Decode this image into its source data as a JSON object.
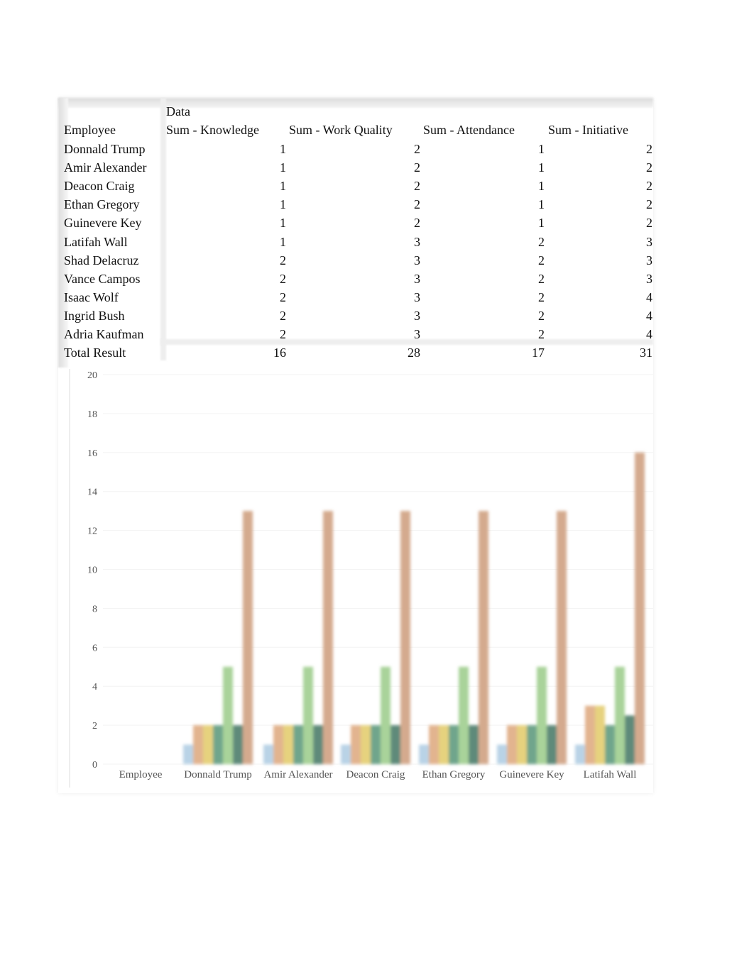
{
  "pivot": {
    "data_label": "Data",
    "row_header": "Employee",
    "columns": [
      "Sum - Knowledge",
      "Sum - Work Quality",
      "Sum - Attendance",
      "Sum - Initiative"
    ],
    "rows": [
      {
        "name": "Donnald Trump",
        "values": [
          1,
          2,
          1,
          2
        ]
      },
      {
        "name": "Amir Alexander",
        "values": [
          1,
          2,
          1,
          2
        ]
      },
      {
        "name": "Deacon Craig",
        "values": [
          1,
          2,
          1,
          2
        ]
      },
      {
        "name": "Ethan Gregory",
        "values": [
          1,
          2,
          1,
          2
        ]
      },
      {
        "name": "Guinevere Key",
        "values": [
          1,
          2,
          1,
          2
        ]
      },
      {
        "name": "Latifah Wall",
        "values": [
          1,
          3,
          2,
          3
        ]
      },
      {
        "name": "Shad Delacruz",
        "values": [
          2,
          3,
          2,
          3
        ]
      },
      {
        "name": "Vance Campos",
        "values": [
          2,
          3,
          2,
          3
        ]
      },
      {
        "name": "Isaac Wolf",
        "values": [
          2,
          3,
          2,
          4
        ]
      },
      {
        "name": "Ingrid Bush",
        "values": [
          2,
          3,
          2,
          4
        ]
      },
      {
        "name": "Adria Kaufman",
        "values": [
          2,
          3,
          2,
          4
        ]
      }
    ],
    "total": {
      "name": "Total Result",
      "values": [
        16,
        28,
        17,
        31
      ]
    }
  },
  "chart_data": {
    "type": "bar",
    "ylim": [
      0,
      20
    ],
    "yticks": [
      0,
      2,
      4,
      6,
      8,
      10,
      12,
      14,
      16,
      18,
      20
    ],
    "categories": [
      "Employee",
      "Donnald Trump",
      "Amir Alexander",
      "Deacon Craig",
      "Ethan Gregory",
      "Guinevere Key",
      "Latifah Wall"
    ],
    "grid": true,
    "series": [
      {
        "color": "#b9d3e6",
        "values": [
          0,
          1,
          1,
          1,
          1,
          1,
          1
        ]
      },
      {
        "color": "#e2b48f",
        "values": [
          0,
          2,
          2,
          2,
          2,
          2,
          3
        ]
      },
      {
        "color": "#e6d27e",
        "values": [
          0,
          2,
          2,
          2,
          2,
          2,
          3
        ]
      },
      {
        "color": "#6fa58c",
        "values": [
          0,
          2,
          2,
          2,
          2,
          2,
          2
        ]
      },
      {
        "color": "#a9d39a",
        "values": [
          0,
          5,
          5,
          5,
          5,
          5,
          5
        ]
      },
      {
        "color": "#5e8a7a",
        "values": [
          0,
          2,
          2,
          2,
          2,
          2,
          2.5
        ]
      },
      {
        "color": "#d4aa8e",
        "values": [
          0,
          13,
          13,
          13,
          13,
          13,
          16
        ]
      }
    ]
  }
}
